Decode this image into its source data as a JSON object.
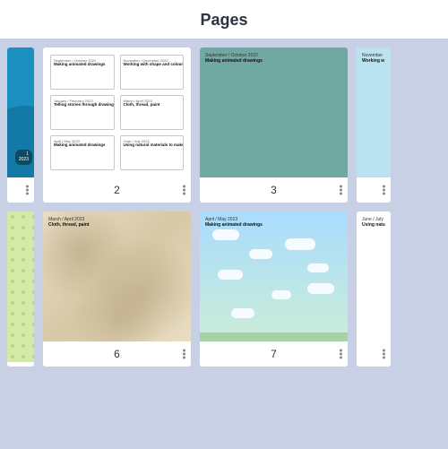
{
  "header": {
    "title": "Pages"
  },
  "cells": [
    {
      "date": "September / October 2022",
      "title": "Making animated drawings"
    },
    {
      "date": "November / December 2022",
      "title": "Working with shape and colour"
    },
    {
      "date": "January / February 2023",
      "title": "Telling stories through drawing and making"
    },
    {
      "date": "March / April 2023",
      "title": "Cloth, thread, paint"
    },
    {
      "date": "April / May 2023",
      "title": "Making animated drawings"
    },
    {
      "date": "June / July 2023",
      "title": "Using natural materials to make images"
    }
  ],
  "cover": {
    "line1": "1",
    "line2": "2023"
  },
  "pages": [
    {
      "num": "2",
      "kind": "grid6"
    },
    {
      "num": "3",
      "kind": "teal",
      "date": "September / October 2022",
      "title": "Making animated drawings"
    },
    {
      "num": "",
      "kind": "lightblue",
      "date": "November",
      "title": "Working w"
    },
    {
      "num": "6",
      "kind": "parch",
      "date": "March / April 2023",
      "title": "Cloth, thread, paint"
    },
    {
      "num": "7",
      "kind": "clouds",
      "date": "April / May 2023",
      "title": "Making animated drawings"
    },
    {
      "num": "",
      "kind": "plainwhite",
      "date": "June / July",
      "title": "Using natu"
    }
  ]
}
